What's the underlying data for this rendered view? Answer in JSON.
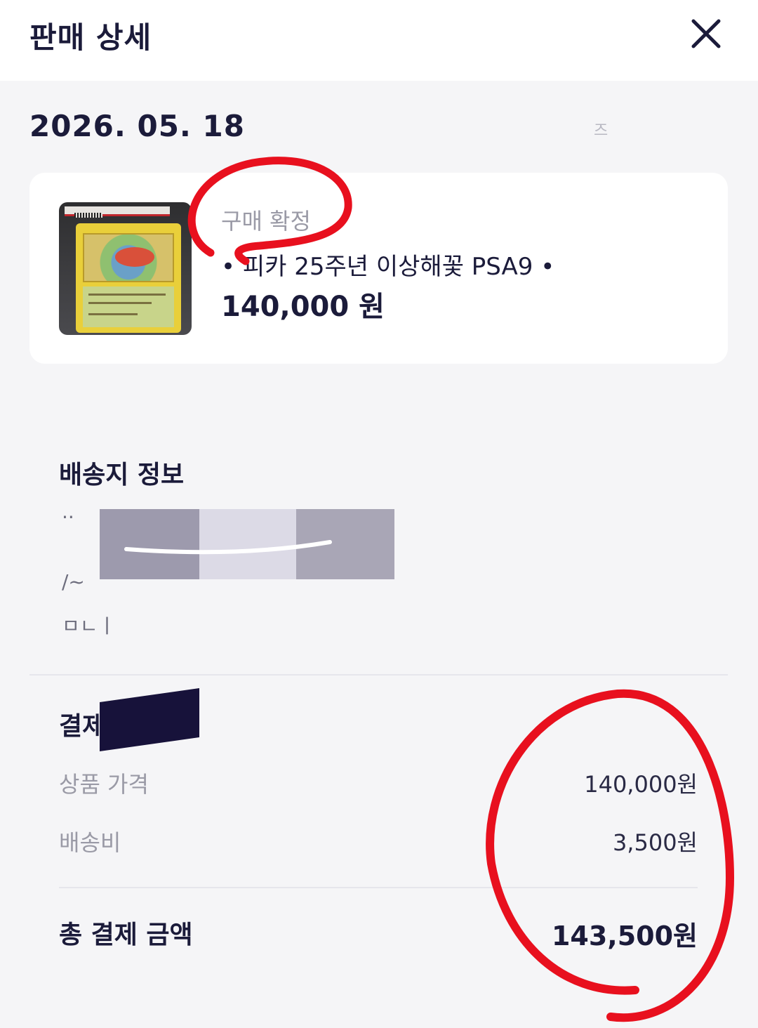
{
  "header": {
    "title": "판매 상세",
    "close_icon": "close-icon"
  },
  "date": {
    "value": "2026. 05. 18",
    "faint_text": "즈"
  },
  "product": {
    "status": "구매 확정",
    "title": "• 피카 25주년 이상해꽃 PSA9 •",
    "price": "140,000 원",
    "thumbnail_icon": "graded-card-image"
  },
  "shipping": {
    "title": "배송지 정보",
    "faint_line_1": "··",
    "faint_line_2": "/~",
    "faint_line_3": "ㅁㄴㅣ"
  },
  "payment": {
    "title": "결제",
    "rows": [
      {
        "label": "상품 가격",
        "value": "140,000원"
      },
      {
        "label": "배송비",
        "value": "3,500원"
      }
    ],
    "total_label": "총 결제 금액",
    "total_value": "143,500원"
  },
  "colors": {
    "background": "#f5f5f7",
    "card": "#ffffff",
    "text_primary": "#1b1b3a",
    "text_secondary": "#9a9aa6",
    "annotation_red": "#e8101e"
  }
}
